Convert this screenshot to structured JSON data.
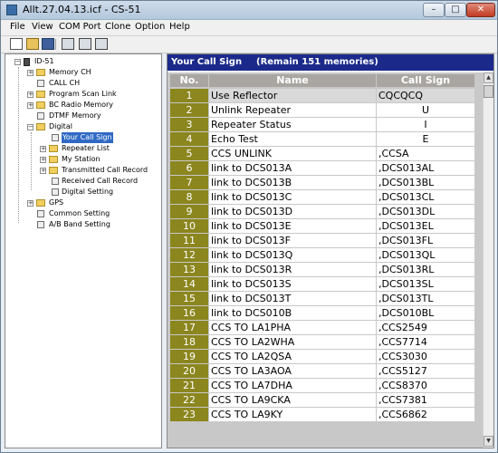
{
  "window": {
    "title": "Allt.27.04.13.icf - CS-51",
    "min_symbol": "–",
    "max_symbol": "□",
    "close_symbol": "✕"
  },
  "menu": [
    "File",
    "View",
    "COM Port",
    "Clone",
    "Option",
    "Help"
  ],
  "toolbar": {
    "icons": [
      "new-file",
      "open-folder",
      "save",
      "device-read",
      "device-write",
      "device-clone"
    ]
  },
  "tree": {
    "root": "ID-51",
    "items": [
      {
        "label": "Memory CH",
        "icon": "folder",
        "expander": "+"
      },
      {
        "label": "CALL CH",
        "icon": "page"
      },
      {
        "label": "Program Scan Link",
        "icon": "folder",
        "expander": "+"
      },
      {
        "label": "BC Radio Memory",
        "icon": "folder",
        "expander": "+"
      },
      {
        "label": "DTMF Memory",
        "icon": "page"
      },
      {
        "label": "Digital",
        "icon": "folder",
        "expander": "−"
      },
      {
        "label": "Your Call Sign",
        "icon": "page",
        "selected": true
      },
      {
        "label": "Repeater List",
        "icon": "folder",
        "expander": "+"
      },
      {
        "label": "My Station",
        "icon": "folder",
        "expander": "+"
      },
      {
        "label": "Transmitted Call Record",
        "icon": "folder",
        "expander": "+"
      },
      {
        "label": "Received Call Record",
        "icon": "page"
      },
      {
        "label": "Digital Setting",
        "icon": "page"
      },
      {
        "label": "GPS",
        "icon": "folder",
        "expander": "+"
      },
      {
        "label": "Common Setting",
        "icon": "page"
      },
      {
        "label": "A/B Band Setting",
        "icon": "page"
      }
    ]
  },
  "panel": {
    "title": "Your Call Sign",
    "remain": "(Remain 151 memories)",
    "columns": {
      "no": "No.",
      "name": "Name",
      "call": "Call Sign"
    },
    "rows": [
      {
        "no": "1",
        "name": "Use Reflector",
        "call": "CQCQCQ",
        "selected": true
      },
      {
        "no": "2",
        "name": "Unlink Repeater",
        "call": "U",
        "center": true
      },
      {
        "no": "3",
        "name": "Repeater Status",
        "call": "I",
        "center": true
      },
      {
        "no": "4",
        "name": "Echo Test",
        "call": "E",
        "center": true
      },
      {
        "no": "5",
        "name": "CCS UNLINK",
        "call": ",CCSA"
      },
      {
        "no": "6",
        "name": "link to DCS013A",
        "call": ",DCS013AL"
      },
      {
        "no": "7",
        "name": "link to DCS013B",
        "call": ",DCS013BL"
      },
      {
        "no": "8",
        "name": "link to DCS013C",
        "call": ",DCS013CL"
      },
      {
        "no": "9",
        "name": "link to DCS013D",
        "call": ",DCS013DL"
      },
      {
        "no": "10",
        "name": "link to DCS013E",
        "call": ",DCS013EL"
      },
      {
        "no": "11",
        "name": "link to DCS013F",
        "call": ",DCS013FL"
      },
      {
        "no": "12",
        "name": "link to DCS013Q",
        "call": ",DCS013QL"
      },
      {
        "no": "13",
        "name": "link to DCS013R",
        "call": ",DCS013RL"
      },
      {
        "no": "14",
        "name": "link to DCS013S",
        "call": ",DCS013SL"
      },
      {
        "no": "15",
        "name": "link to DCS013T",
        "call": ",DCS013TL"
      },
      {
        "no": "16",
        "name": "link to DCS010B",
        "call": ",DCS010BL"
      },
      {
        "no": "17",
        "name": "CCS TO LA1PHA",
        "call": ",CCS2549"
      },
      {
        "no": "18",
        "name": "CCS TO LA2WHA",
        "call": ",CCS7714"
      },
      {
        "no": "19",
        "name": "CCS TO LA2QSA",
        "call": ",CCS3030"
      },
      {
        "no": "20",
        "name": "CCS TO LA3AOA",
        "call": ",CCS5127"
      },
      {
        "no": "21",
        "name": "CCS TO LA7DHA",
        "call": ",CCS8370"
      },
      {
        "no": "22",
        "name": "CCS TO LA9CKA",
        "call": ",CCS7381"
      },
      {
        "no": "23",
        "name": "CCS TO LA9KY",
        "call": ",CCS6862"
      }
    ]
  },
  "colors": {
    "header_bg": "#1b2a8a",
    "no_cell": "#8b861e",
    "col_header": "#a9a6a1",
    "selection": "#316ac5"
  }
}
